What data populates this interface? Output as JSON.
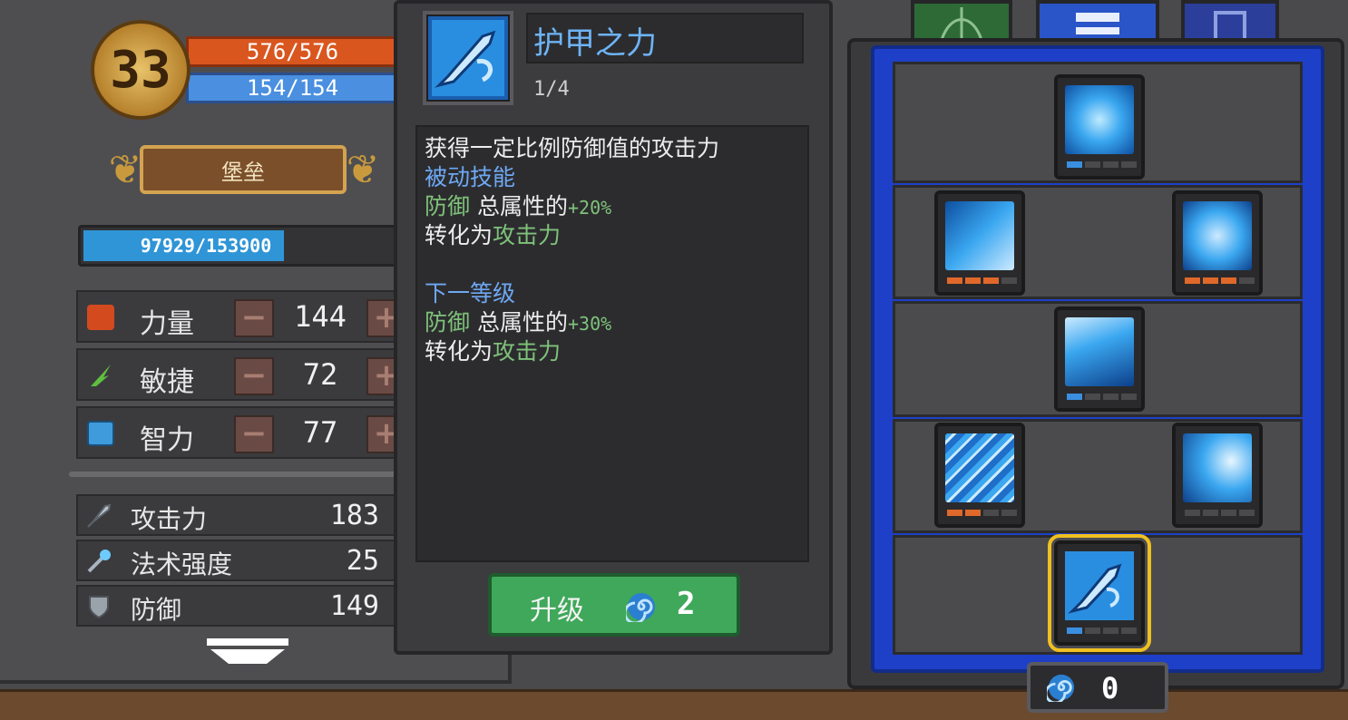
{
  "character": {
    "level": "33",
    "hp": "576/576",
    "mp": "154/154",
    "title": "堡垒",
    "experience": "97929/153900",
    "experience_fraction": 0.636
  },
  "attributes": [
    {
      "label": "力量",
      "value": "144",
      "icon": "fist-icon"
    },
    {
      "label": "敏捷",
      "value": "72",
      "icon": "feather-icon"
    },
    {
      "label": "智力",
      "value": "77",
      "icon": "book-icon"
    }
  ],
  "stats": [
    {
      "label": "攻击力",
      "value": "183",
      "icon": "sword-icon"
    },
    {
      "label": "法术强度",
      "value": "25",
      "icon": "wand-icon"
    },
    {
      "label": "防御",
      "value": "149",
      "icon": "shield-icon"
    }
  ],
  "tooltip": {
    "name": "护甲之力",
    "level": "1/4",
    "description": "获得一定比例防御值的攻击力",
    "type": "被动技能",
    "current": {
      "stat": "防御",
      "mid": "总属性的",
      "pct": "+20%",
      "line2a": "转化为",
      "line2b": "攻击力"
    },
    "next_header": "下一等级",
    "next": {
      "stat": "防御",
      "mid": "总属性的",
      "pct": "+30%",
      "line2a": "转化为",
      "line2b": "攻击力"
    },
    "upgrade_label": "升级",
    "upgrade_cost": "2"
  },
  "skill_points": "0",
  "colors": {
    "accent_blue": "#6ea8f2",
    "accent_green": "#7fc27a",
    "hp": "#d9561f",
    "mp": "#4a8fe0",
    "button": "#3fa85a",
    "tree_frame": "#1e40c8",
    "pip_blue": "#3a8fe0",
    "pip_orange": "#e0682a"
  }
}
